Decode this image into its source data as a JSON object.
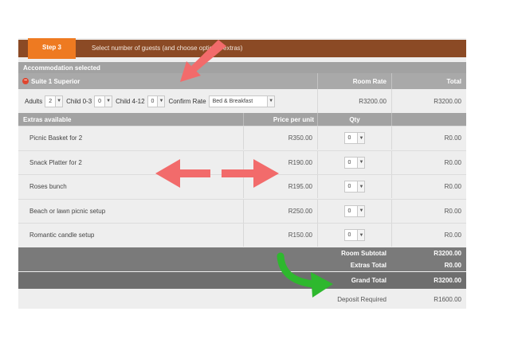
{
  "step": {
    "label": "Step 3",
    "description": "Select number of guests (and choose optional extras)"
  },
  "accommodation": {
    "section_title": "Accommodation selected",
    "suite_name": "Suite 1 Superior",
    "room_rate_header": "Room Rate",
    "total_header": "Total",
    "adults_label": "Adults",
    "adults_value": "2",
    "child_0_3_label": "Child 0-3",
    "child_0_3_value": "0",
    "child_4_12_label": "Child 4-12",
    "child_4_12_value": "0",
    "confirm_rate_label": "Confirm Rate",
    "confirm_rate_value": "Bed & Breakfast",
    "room_rate": "R3200.00",
    "total": "R3200.00"
  },
  "extras": {
    "header": "Extras available",
    "price_header": "Price per unit",
    "qty_header": "Qty",
    "items": [
      {
        "name": "Picnic Basket for 2",
        "price": "R350.00",
        "qty": "0",
        "total": "R0.00"
      },
      {
        "name": "Snack Platter for 2",
        "price": "R190.00",
        "qty": "0",
        "total": "R0.00"
      },
      {
        "name": "Roses bunch",
        "price": "R195.00",
        "qty": "0",
        "total": "R0.00"
      },
      {
        "name": "Beach or lawn picnic setup",
        "price": "R250.00",
        "qty": "0",
        "total": "R0.00"
      },
      {
        "name": "Romantic candle setup",
        "price": "R150.00",
        "qty": "0",
        "total": "R0.00"
      }
    ]
  },
  "summary": {
    "room_subtotal_label": "Room Subtotal",
    "room_subtotal": "R3200.00",
    "extras_total_label": "Extras Total",
    "extras_total": "R0.00",
    "grand_total_label": "Grand Total",
    "grand_total": "R3200.00",
    "deposit_label": "Deposit Required",
    "deposit": "R1600.00"
  },
  "icons": {
    "remove": "minus-circle-icon",
    "dropdown": "chevron-down-icon"
  },
  "colors": {
    "step_bar": "#8b4a25",
    "step_tab": "#ee7a21",
    "arrow_red": "#f25a5a",
    "arrow_green": "#2db52d"
  }
}
